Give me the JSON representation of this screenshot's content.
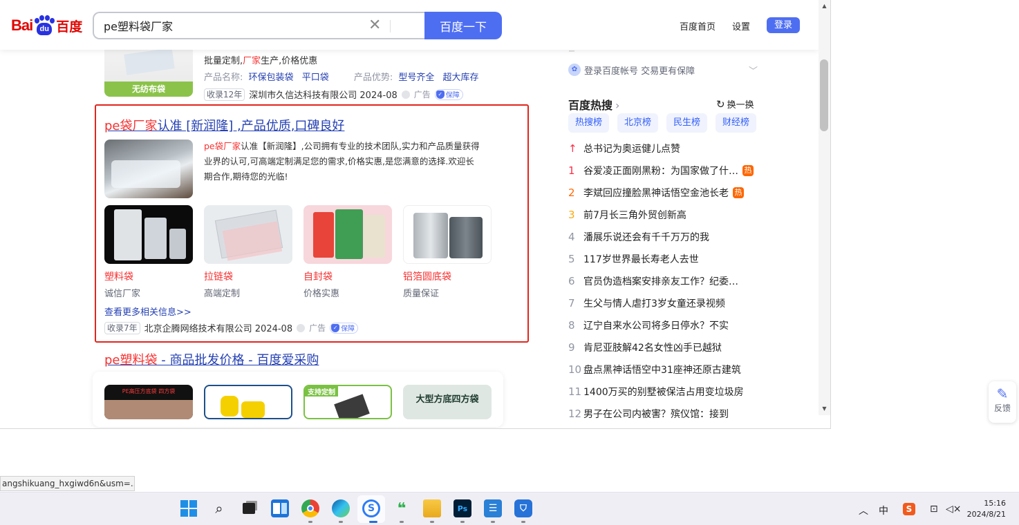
{
  "header": {
    "logo_left": "Bai",
    "logo_paw": "du",
    "logo_right": "百度",
    "search_value": "pe塑料袋厂家",
    "search_button": "百度一下",
    "links": [
      "百度首页",
      "设置"
    ],
    "login": "登录"
  },
  "result_top": {
    "img_label": "无纺布袋",
    "desc_pre": "批量定制,",
    "desc_hl": "厂家",
    "desc_post": "生产,价格优惠",
    "name_label": "产品名称:",
    "names": [
      "环保包装袋",
      "平口袋"
    ],
    "adv_label": "产品优势:",
    "advs": [
      "型号齐全",
      "超大库存"
    ],
    "age": "收录12年",
    "company": "深圳市久信达科技有限公司 2024-08",
    "ad": "广告",
    "bao": "保障"
  },
  "result_ad": {
    "title_hl": "pe袋厂家",
    "title_rest": "认准 [新润隆] ,产品优质,口碑良好",
    "desc_hl": "pe袋厂家",
    "desc_line1": "认准【新润隆】,公司拥有专业的技术团队,实力和产品质量获得",
    "desc_line2": "业界的认可,可高端定制满足您的需求,价格实惠,是您满意的选择.欢迎长",
    "desc_line3": "期合作,期待您的光临!",
    "products": [
      {
        "name": "塑料袋",
        "sub": "诚信厂家"
      },
      {
        "name": "拉链袋",
        "sub": "高端定制"
      },
      {
        "name": "自封袋",
        "sub": "价格实惠"
      },
      {
        "name": "铝箔圆底袋",
        "sub": "质量保证"
      }
    ],
    "more": "查看更多相关信息>>",
    "age": "收录7年",
    "company": "北京企腾网络技术有限公司 2024-08",
    "ad": "广告",
    "bao": "保障"
  },
  "result_3": {
    "title_hl": "pe塑料袋",
    "title_rest": " - 商品批发价格 - 百度爱采购",
    "img_labels": [
      "PE高压方底袋 四方袋",
      "",
      "支持定制",
      "大型方底四方袋"
    ]
  },
  "right": {
    "login_tip": "登录百度帐号 交易更有保障",
    "hot_title": "百度热搜",
    "refresh": "换一换",
    "tabs": [
      "热搜榜",
      "北京榜",
      "民生榜",
      "财经榜"
    ],
    "items": [
      {
        "rank": "↑",
        "text": "总书记为奥运健儿点赞",
        "hot": ""
      },
      {
        "rank": "1",
        "text": "谷爱凌正面刚黑粉：为国家做了什…",
        "hot": "热"
      },
      {
        "rank": "2",
        "text": "李斌回应撞脸黑神话悟空金池长老",
        "hot": "热"
      },
      {
        "rank": "3",
        "text": "前7月长三角外贸创新高",
        "hot": ""
      },
      {
        "rank": "4",
        "text": "潘展乐说还会有千千万万的我",
        "hot": ""
      },
      {
        "rank": "5",
        "text": "117岁世界最长寿老人去世",
        "hot": ""
      },
      {
        "rank": "6",
        "text": "官员伪造档案安排亲友工作？纪委…",
        "hot": ""
      },
      {
        "rank": "7",
        "text": "生父与情人虐打3岁女童还录视频",
        "hot": ""
      },
      {
        "rank": "8",
        "text": "辽宁自来水公司将多日停水？不实",
        "hot": ""
      },
      {
        "rank": "9",
        "text": "肯尼亚肢解42名女性凶手已越狱",
        "hot": ""
      },
      {
        "rank": "10",
        "text": "盘点黑神话悟空中31座神还原古建筑",
        "hot": ""
      },
      {
        "rank": "11",
        "text": "1400万买的别墅被保洁占用变垃圾房",
        "hot": ""
      },
      {
        "rank": "12",
        "text": "男子在公司内被害？殡仪馆：接到",
        "hot": ""
      }
    ]
  },
  "feedback": "反馈",
  "status_url": "angshikuang_hxgiwd6n&usm=...",
  "taskbar": {
    "ime": "中",
    "time": "15:16",
    "date": "2024/8/21"
  }
}
